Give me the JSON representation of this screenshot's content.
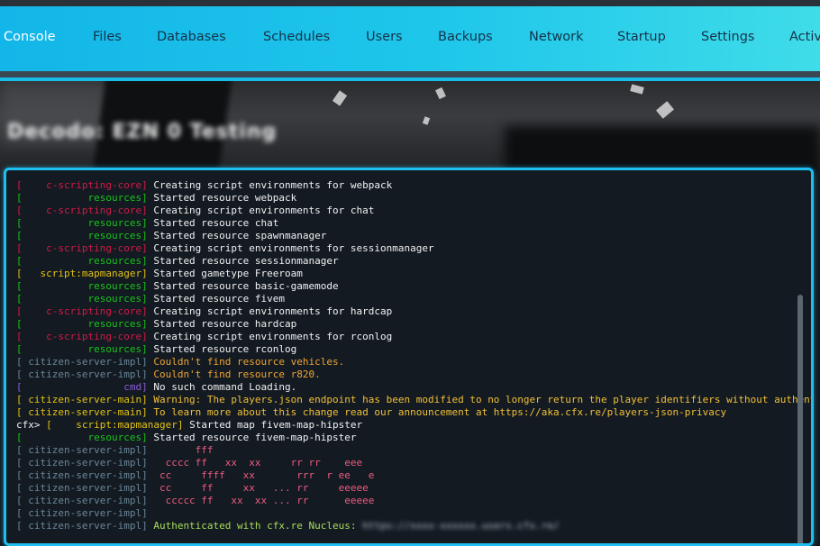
{
  "nav": {
    "tabs": [
      {
        "label": "Console",
        "active": true
      },
      {
        "label": "Files"
      },
      {
        "label": "Databases"
      },
      {
        "label": "Schedules"
      },
      {
        "label": "Users"
      },
      {
        "label": "Backups"
      },
      {
        "label": "Network"
      },
      {
        "label": "Startup"
      },
      {
        "label": "Settings"
      },
      {
        "label": "Activ"
      }
    ]
  },
  "server": {
    "title_blurred": "Decodo: EZN 0 Testing"
  },
  "console": {
    "lines": [
      {
        "prefix": "[",
        "tag": "    c-scripting-core]",
        "tag_color": "red",
        "message": " Creating script environments for webpack",
        "msg_color": "white"
      },
      {
        "prefix": "[",
        "tag": "           resources]",
        "tag_color": "green",
        "message": " Started resource webpack",
        "msg_color": "white"
      },
      {
        "prefix": "[",
        "tag": "    c-scripting-core]",
        "tag_color": "red",
        "message": " Creating script environments for chat",
        "msg_color": "white"
      },
      {
        "prefix": "[",
        "tag": "           resources]",
        "tag_color": "green",
        "message": " Started resource chat",
        "msg_color": "white"
      },
      {
        "prefix": "[",
        "tag": "           resources]",
        "tag_color": "green",
        "message": " Started resource spawnmanager",
        "msg_color": "white"
      },
      {
        "prefix": "[",
        "tag": "    c-scripting-core]",
        "tag_color": "red",
        "message": " Creating script environments for sessionmanager",
        "msg_color": "white"
      },
      {
        "prefix": "[",
        "tag": "           resources]",
        "tag_color": "green",
        "message": " Started resource sessionmanager",
        "msg_color": "white"
      },
      {
        "prefix": "[",
        "tag": "   script:mapmanager]",
        "tag_color": "yellow",
        "message": " Started gametype Freeroam",
        "msg_color": "white"
      },
      {
        "prefix": "[",
        "tag": "           resources]",
        "tag_color": "green",
        "message": " Started resource basic-gamemode",
        "msg_color": "white"
      },
      {
        "prefix": "[",
        "tag": "           resources]",
        "tag_color": "green",
        "message": " Started resource fivem",
        "msg_color": "white"
      },
      {
        "prefix": "[",
        "tag": "    c-scripting-core]",
        "tag_color": "red",
        "message": " Creating script environments for hardcap",
        "msg_color": "white"
      },
      {
        "prefix": "[",
        "tag": "           resources]",
        "tag_color": "green",
        "message": " Started resource hardcap",
        "msg_color": "white"
      },
      {
        "prefix": "[",
        "tag": "    c-scripting-core]",
        "tag_color": "red",
        "message": " Creating script environments for rconlog",
        "msg_color": "white"
      },
      {
        "prefix": "[",
        "tag": "           resources]",
        "tag_color": "green",
        "message": " Started resource rconlog",
        "msg_color": "white"
      },
      {
        "prefix": "[",
        "tag": " citizen-server-impl]",
        "tag_color": "slate",
        "message": " Couldn't find resource vehicles.",
        "msg_color": "orange"
      },
      {
        "prefix": "[",
        "tag": " citizen-server-impl]",
        "tag_color": "slate",
        "message": " Couldn't find resource r820.",
        "msg_color": "orange"
      },
      {
        "prefix": "[",
        "tag": "                 cmd]",
        "tag_color": "purple",
        "message": " No such command Loading.",
        "msg_color": "white"
      },
      {
        "prefix": "[",
        "tag": " citizen-server-main]",
        "tag_color": "yellow",
        "message": " Warning: The players.json endpoint has been modified to no longer return the player identifiers without authentication.",
        "msg_color": "gold"
      },
      {
        "prefix": "[",
        "tag": " citizen-server-main]",
        "tag_color": "yellow",
        "message": " To learn more about this change read our announcement at https://aka.cfx.re/players-json-privacy",
        "msg_color": "gold"
      },
      {
        "prefix": "cfx> [",
        "tag": "    script:mapmanager]",
        "tag_color": "yellow",
        "message": " Started map fivem-map-hipster",
        "msg_color": "white"
      },
      {
        "prefix": "[",
        "tag": "           resources]",
        "tag_color": "green",
        "message": " Started resource fivem-map-hipster",
        "msg_color": "white"
      },
      {
        "prefix": "[",
        "tag": " citizen-server-impl]",
        "tag_color": "slate",
        "message": "        fff",
        "msg_color": "pink"
      },
      {
        "prefix": "[",
        "tag": " citizen-server-impl]",
        "tag_color": "slate",
        "message": "   cccc ff   xx  xx     rr rr    eee",
        "msg_color": "pink"
      },
      {
        "prefix": "[",
        "tag": " citizen-server-impl]",
        "tag_color": "slate",
        "message": "  cc     ffff   xx       rrr  r ee   e",
        "msg_color": "pink"
      },
      {
        "prefix": "[",
        "tag": " citizen-server-impl]",
        "tag_color": "slate",
        "message": "  cc     ff     xx   ... rr     eeeee",
        "msg_color": "pink"
      },
      {
        "prefix": "[",
        "tag": " citizen-server-impl]",
        "tag_color": "slate",
        "message": "   ccccc ff   xx  xx ... rr      eeeee",
        "msg_color": "pink"
      },
      {
        "prefix": "[",
        "tag": " citizen-server-impl]",
        "tag_color": "slate",
        "message": "",
        "msg_color": "white"
      },
      {
        "prefix": "[",
        "tag": " citizen-server-impl]",
        "tag_color": "slate",
        "message": " Authenticated with cfx.re Nucleus: ",
        "msg_color": "lime",
        "redacted": "https://xxxx-xxxxxx.users.cfx.re/"
      }
    ]
  }
}
